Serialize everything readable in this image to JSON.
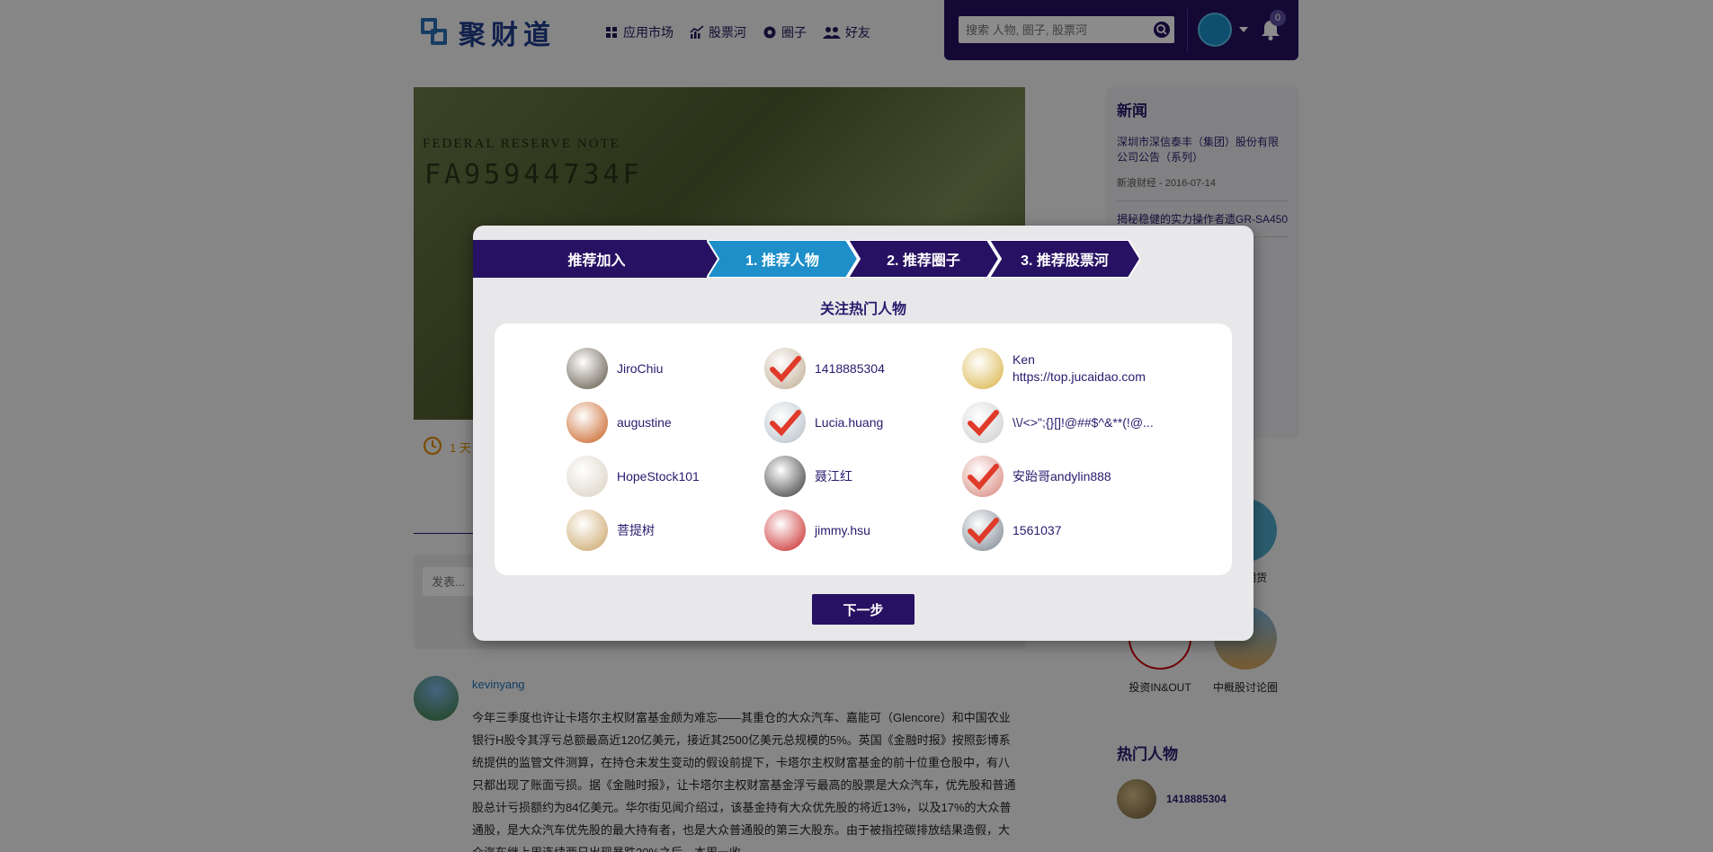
{
  "header": {
    "logo_text": "聚财道",
    "nav": [
      {
        "label": "应用市场",
        "icon": "grid-icon"
      },
      {
        "label": "股票河",
        "icon": "chart-icon"
      },
      {
        "label": "圈子",
        "icon": "circle-group-icon"
      },
      {
        "label": "好友",
        "icon": "friends-icon"
      }
    ],
    "search_placeholder": "搜索 人物, 圈子, 股票河",
    "notification_count": "0"
  },
  "background": {
    "hero_label": "FEDERAL RESERVE NOTE",
    "hero_serial": "FA95944734F",
    "time_text": "1 天",
    "post_placeholder": "发表...",
    "feed": {
      "author": "kevinyang",
      "text": "今年三季度也许让卡塔尔主权财富基金颇为难忘——其重仓的大众汽车、嘉能可（Glencore）和中国农业银行H股令其浮亏总额最高近120亿美元，接近其2500亿美元总规模的5%。英国《金融时报》按照彭博系统提供的监管文件测算，在持仓未发生变动的假设前提下，卡塔尔主权财富基金的前十位重仓股中，有八只都出现了账面亏损。据《金融时报》，让卡塔尔主权财富基金浮亏最高的股票是大众汽车，优先股和普通股总计亏损额约为84亿美元。华尔街见闻介绍过，该基金持有大众优先股的将近13%，以及17%的大众普通股，是大众汽车优先股的最大持有者，也是大众普通股的第三大股东。由于被指控碳排放结果造假，大众汽车继上周连续两日出现暴跌20%之后，本周一收"
    },
    "news": {
      "title": "新闻",
      "items": [
        {
          "text": "深圳市深信泰丰（集团）股份有限公司公告（系列）",
          "meta": "新浪财经 - 2016-07-14"
        },
        {
          "text": "揭秘稳健的实力操作者遗GR-SA450",
          "meta": ""
        }
      ]
    },
    "side_groups": [
      {
        "label": "投资期货"
      },
      {
        "label": "投资IN&OUT"
      },
      {
        "label": "中概股讨论圈"
      }
    ],
    "hot_people": {
      "title": "热门人物",
      "first": "1418885304"
    }
  },
  "modal": {
    "steps": [
      {
        "label": "推荐加入",
        "active": false
      },
      {
        "label": "1. 推荐人物",
        "active": true
      },
      {
        "label": "2. 推荐圈子",
        "active": false
      },
      {
        "label": "3. 推荐股票河",
        "active": false
      }
    ],
    "heading": "关注热门人物",
    "people": [
      {
        "name": "JiroChiu",
        "sub": "",
        "checked": false,
        "color": "#5a5040"
      },
      {
        "name": "1418885304",
        "sub": "",
        "checked": true,
        "color": "#9a7c55"
      },
      {
        "name": "Ken",
        "sub": "https://top.jucaidao.com",
        "checked": false,
        "color": "#d8b040"
      },
      {
        "name": "augustine",
        "sub": "",
        "checked": false,
        "color": "#c55a18"
      },
      {
        "name": "Lucia.huang",
        "sub": "",
        "checked": true,
        "color": "#8a9aa8"
      },
      {
        "name": "\\\\/<>\";{}[]!@##$^&**(!@...",
        "sub": "",
        "checked": true,
        "color": "#b0b0b0"
      },
      {
        "name": "HopeStock101",
        "sub": "",
        "checked": false,
        "color": "#d8d0c0"
      },
      {
        "name": "聂江红",
        "sub": "",
        "checked": false,
        "color": "#333333"
      },
      {
        "name": "安跆哥andylin888",
        "sub": "",
        "checked": true,
        "color": "#c04030"
      },
      {
        "name": "菩提树",
        "sub": "",
        "checked": false,
        "color": "#c8a060"
      },
      {
        "name": "jimmy.hsu",
        "sub": "",
        "checked": false,
        "color": "#c81e1e"
      },
      {
        "name": "1561037",
        "sub": "",
        "checked": true,
        "color": "#2c3e50"
      }
    ],
    "next_label": "下一步",
    "colors": {
      "step_inactive": "#261162",
      "step_active": "#1e8fc8",
      "check": "#e03a2a"
    }
  }
}
